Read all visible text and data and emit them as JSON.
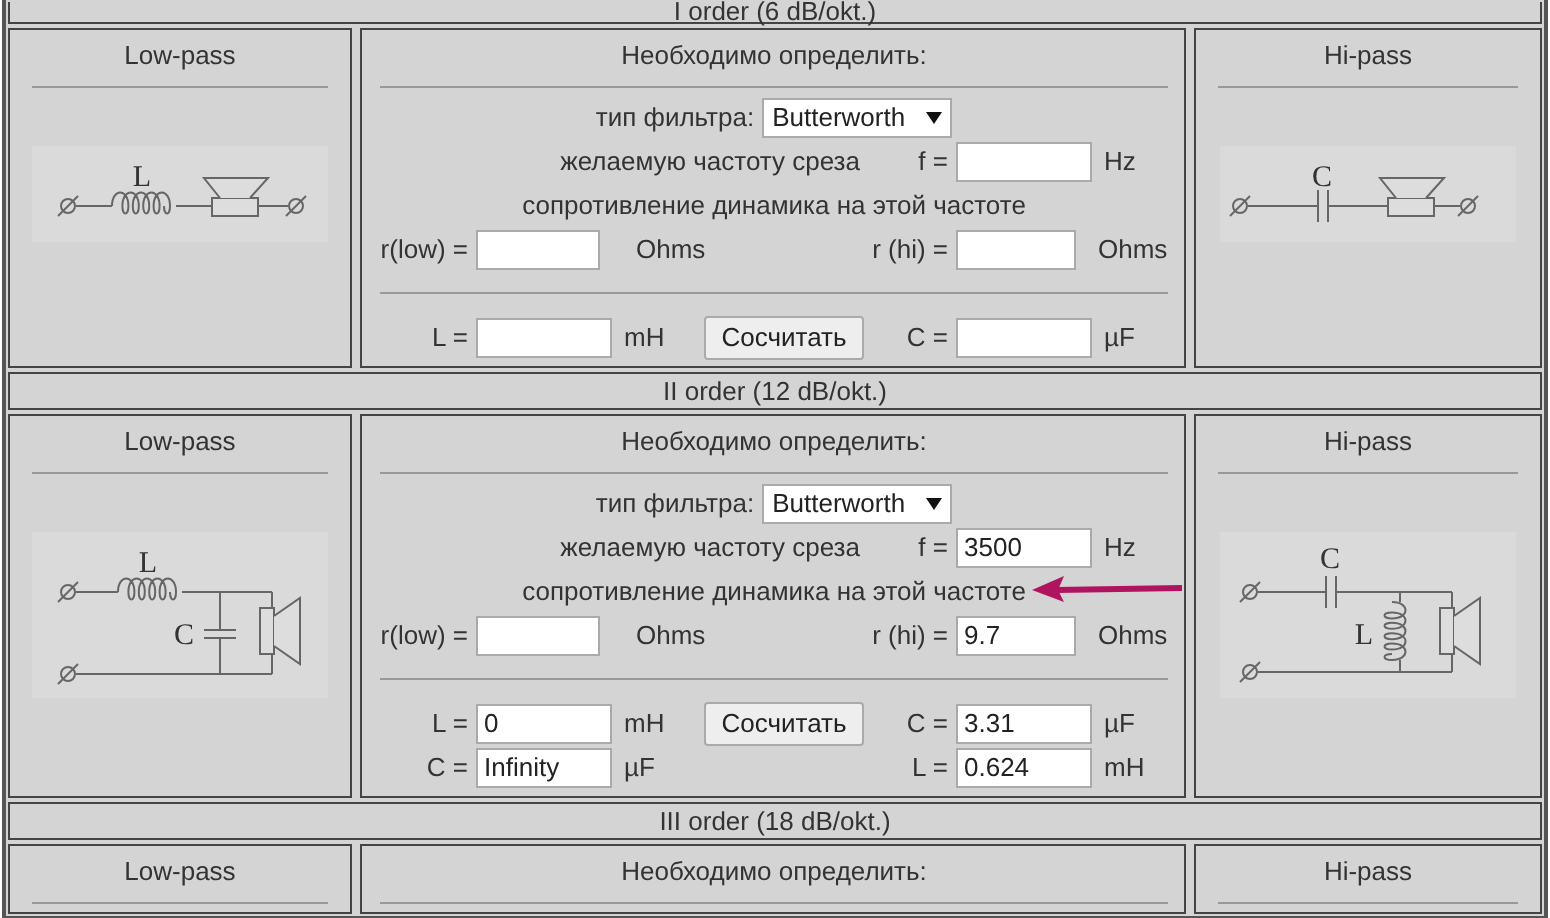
{
  "sections": [
    {
      "header": "I order (6 dB/okt.)",
      "low_pass": {
        "title": "Low-pass",
        "diagram": {
          "kind": "series-l",
          "labels": [
            "L"
          ]
        }
      },
      "calc": {
        "title": "Необходимо определить:",
        "filter_label": "тип фильтра:",
        "filter_value": "Butterworth",
        "cutoff_label": "желаемую частоту среза",
        "f_label": "f =",
        "f_unit": "Hz",
        "impedance_label": "сопротивление динамика на этой частоте",
        "r_low": {
          "label": "r(low) =",
          "unit": "Ohms"
        },
        "r_hi": {
          "label": "r (hi) =",
          "unit": "Ohms"
        },
        "button": "Сосчитать",
        "results": [
          {
            "left": {
              "label": "L =",
              "unit": "mH"
            },
            "right": {
              "label": "C =",
              "unit": "µF"
            }
          }
        ]
      },
      "high_pass": {
        "title": "Hi-pass",
        "diagram": {
          "kind": "series-c",
          "labels": [
            "C"
          ]
        }
      }
    },
    {
      "header": "II order (12 dB/okt.)",
      "low_pass": {
        "title": "Low-pass",
        "diagram": {
          "kind": "l-c",
          "labels": [
            "L",
            "C"
          ]
        }
      },
      "calc": {
        "title": "Необходимо определить:",
        "filter_label": "тип фильтра:",
        "filter_value": "Butterworth",
        "cutoff_label": "желаемую частоту среза",
        "f_label": "f =",
        "f_value": "3500",
        "f_unit": "Hz",
        "impedance_label": "сопротивление динамика на этой частоте",
        "arrow": true,
        "r_low": {
          "label": "r(low) =",
          "unit": "Ohms"
        },
        "r_hi": {
          "label": "r (hi) =",
          "value": "9.7",
          "unit": "Ohms"
        },
        "button": "Сосчитать",
        "results": [
          {
            "left": {
              "label": "L =",
              "value": "0",
              "unit": "mH"
            },
            "right": {
              "label": "C =",
              "value": "3.31",
              "unit": "µF"
            }
          },
          {
            "left": {
              "label": "C =",
              "value": "Infinity",
              "unit": "µF"
            },
            "right": {
              "label": "L =",
              "value": "0.624",
              "unit": "mH"
            }
          }
        ]
      },
      "high_pass": {
        "title": "Hi-pass",
        "diagram": {
          "kind": "c-l",
          "labels": [
            "C",
            "L"
          ]
        }
      }
    },
    {
      "header": "III order (18 dB/okt.)",
      "low_pass": {
        "title": "Low-pass"
      },
      "calc": {
        "title": "Необходимо определить:"
      },
      "high_pass": {
        "title": "Hi-pass"
      }
    }
  ]
}
